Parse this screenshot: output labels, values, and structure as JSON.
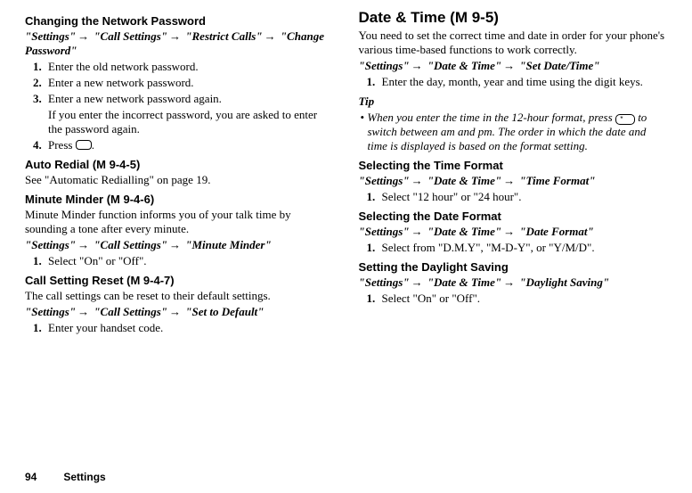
{
  "left": {
    "sec1": {
      "title": "Changing the Network Password",
      "path_parts": [
        "\"Settings\"",
        "\"Call Settings\"",
        "\"Restrict Calls\"",
        "\"Change Password\""
      ],
      "steps": [
        "Enter the old network password.",
        "Enter a new network password.",
        "Enter a new network password again."
      ],
      "step3_note": "If you enter the incorrect password, you are asked to enter the password again.",
      "step4_a": "Press ",
      "step4_b": "."
    },
    "sec2": {
      "title": "Auto Redial ",
      "code": "(M 9-4-5)",
      "body": "See \"Automatic Redialling\" on page 19."
    },
    "sec3": {
      "title": "Minute Minder ",
      "code": "(M 9-4-6)",
      "body": "Minute Minder function informs you of your talk time by sounding a tone after every minute.",
      "path_parts": [
        "\"Settings\"",
        "\"Call Settings\"",
        "\"Minute Minder\""
      ],
      "step": "Select \"On\" or \"Off\"."
    },
    "sec4": {
      "title": "Call Setting Reset ",
      "code": "(M 9-4-7)",
      "body": "The call settings can be reset to their default settings.",
      "path_parts": [
        " \"Settings\"",
        "\"Call Settings\"",
        "\"Set to Default\""
      ],
      "step": "Enter your handset code."
    }
  },
  "right": {
    "title": "Date & Time ",
    "code": "(M 9-5)",
    "intro": "You need to set the correct time and date in order for your phone's various time-based functions to work correctly.",
    "path_parts": [
      "\"Settings\"",
      "\"Date & Time\"",
      "\"Set Date/Time\""
    ],
    "step": "Enter the day, month, year and time using the digit keys.",
    "tip_hd": "Tip",
    "tip_a": "When you enter the time in the 12-hour format, press ",
    "tip_key": "*",
    "tip_b": " to switch between am and pm. The order in which the date and time is displayed is based on the format setting.",
    "sec_tf": {
      "title": "Selecting the Time Format",
      "path_parts": [
        "\"Settings\"",
        "\"Date & Time\"",
        "\"Time Format\""
      ],
      "step": "Select \"12 hour\" or \"24 hour\"."
    },
    "sec_df": {
      "title": "Selecting the Date Format",
      "path_parts": [
        "\"Settings\"",
        "\"Date & Time\"",
        "\"Date Format\""
      ],
      "step": "Select from \"D.M.Y\", \"M-D-Y\", or \"Y/M/D\"."
    },
    "sec_ds": {
      "title": "Setting the Daylight Saving",
      "path_parts": [
        "\"Settings\"",
        "\"Date & Time\"",
        "\"Daylight Saving\""
      ],
      "step": "Select \"On\" or \"Off\"."
    }
  },
  "footer": {
    "page": "94",
    "section": "Settings"
  },
  "arrow": "→"
}
